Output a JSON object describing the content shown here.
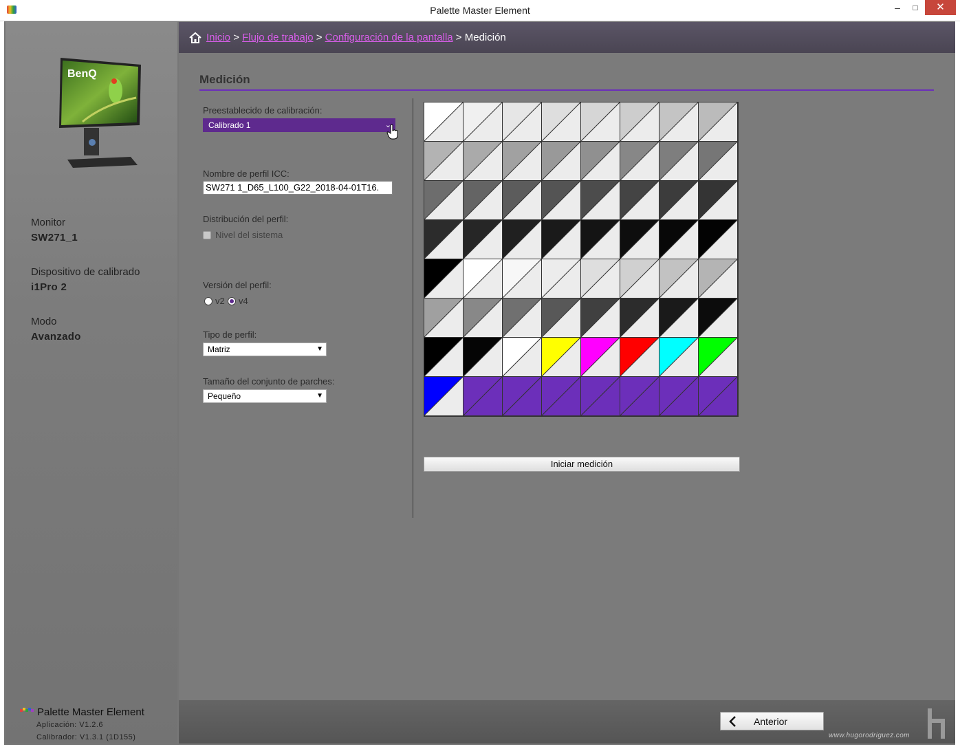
{
  "window": {
    "title": "Palette Master Element",
    "minimize": "–",
    "maximize": "□",
    "close": "✕"
  },
  "sidebar": {
    "monitor_label": "Monitor",
    "monitor_value": "SW271_1",
    "device_label": "Dispositivo de calibrado",
    "device_value": "i1Pro 2",
    "mode_label": "Modo",
    "mode_value": "Avanzado",
    "monitor_brand": "BenQ",
    "app_name": "Palette Master Element",
    "app_version": "Aplicación: V1.2.6",
    "calibrator_version": "Calibrador: V1.3.1 (1D155)"
  },
  "breadcrumb": {
    "home_icon": "home-icon",
    "items": [
      "Inicio",
      "Flujo de trabajo",
      "Configuración de la pantalla"
    ],
    "separator": ">",
    "current": "Medición"
  },
  "section": {
    "title": "Medición"
  },
  "form": {
    "preset_label": "Preestablecido de calibración:",
    "preset_value": "Calibrado 1",
    "icc_label": "Nombre de perfil ICC:",
    "icc_value": "SW271 1_D65_L100_G22_2018-04-01T16.",
    "distribution_label": "Distribución del perfil:",
    "system_level_label": "Nivel del sistema",
    "version_label": "Versión del perfil:",
    "version_options": [
      "v2",
      "v4"
    ],
    "version_selected": "v4",
    "type_label": "Tipo de perfil:",
    "type_value": "Matriz",
    "patch_set_label": "Tamaño del conjunto de parches:",
    "patch_set_value": "Pequeño"
  },
  "patches": [
    [
      "#ffffff",
      "#f0f0f0",
      "#e6e6e6",
      "#dedede",
      "#d6d6d6",
      "#cdcdcd",
      "#c4c4c4",
      "#bbbbbb"
    ],
    [
      "#b3b3b3",
      "#aaaaaa",
      "#a1a1a1",
      "#999999",
      "#909090",
      "#878787",
      "#7e7e7e",
      "#767676"
    ],
    [
      "#6d6d6d",
      "#646464",
      "#5c5c5c",
      "#545454",
      "#4c4c4c",
      "#444444",
      "#3c3c3c",
      "#343434"
    ],
    [
      "#2c2c2c",
      "#262626",
      "#202020",
      "#1a1a1a",
      "#141414",
      "#0e0e0e",
      "#080808",
      "#030303"
    ],
    [
      "#000000",
      "#ffffff",
      "#f7f7f7",
      "#ececec",
      "#dedede",
      "#d0d0d0",
      "#c2c2c2",
      "#b4b4b4"
    ],
    [
      "#a0a0a0",
      "#888888",
      "#707070",
      "#585858",
      "#404040",
      "#2c2c2c",
      "#1a1a1a",
      "#0c0c0c"
    ],
    [
      "#000000",
      "#050505",
      "#ffffff",
      "#ffff00",
      "#ff00ff",
      "#ff0000",
      "#00ffff",
      "#00ff00"
    ],
    [
      "#0000ff",
      "#6c2fba",
      "#6c2fba",
      "#6c2fba",
      "#6c2fba",
      "#6c2fba",
      "#6c2fba",
      "#6c2fba"
    ]
  ],
  "patch_reference_color": "#ececec",
  "patch_pending_color": "#6c2fba",
  "patches_measured": 57,
  "start_button": "Iniciar medición",
  "footer": {
    "prev_button": "Anterior",
    "watermark": "www.hugorodriguez.com"
  },
  "colors": {
    "accent": "#6b2fba",
    "link": "#d75ee8"
  }
}
